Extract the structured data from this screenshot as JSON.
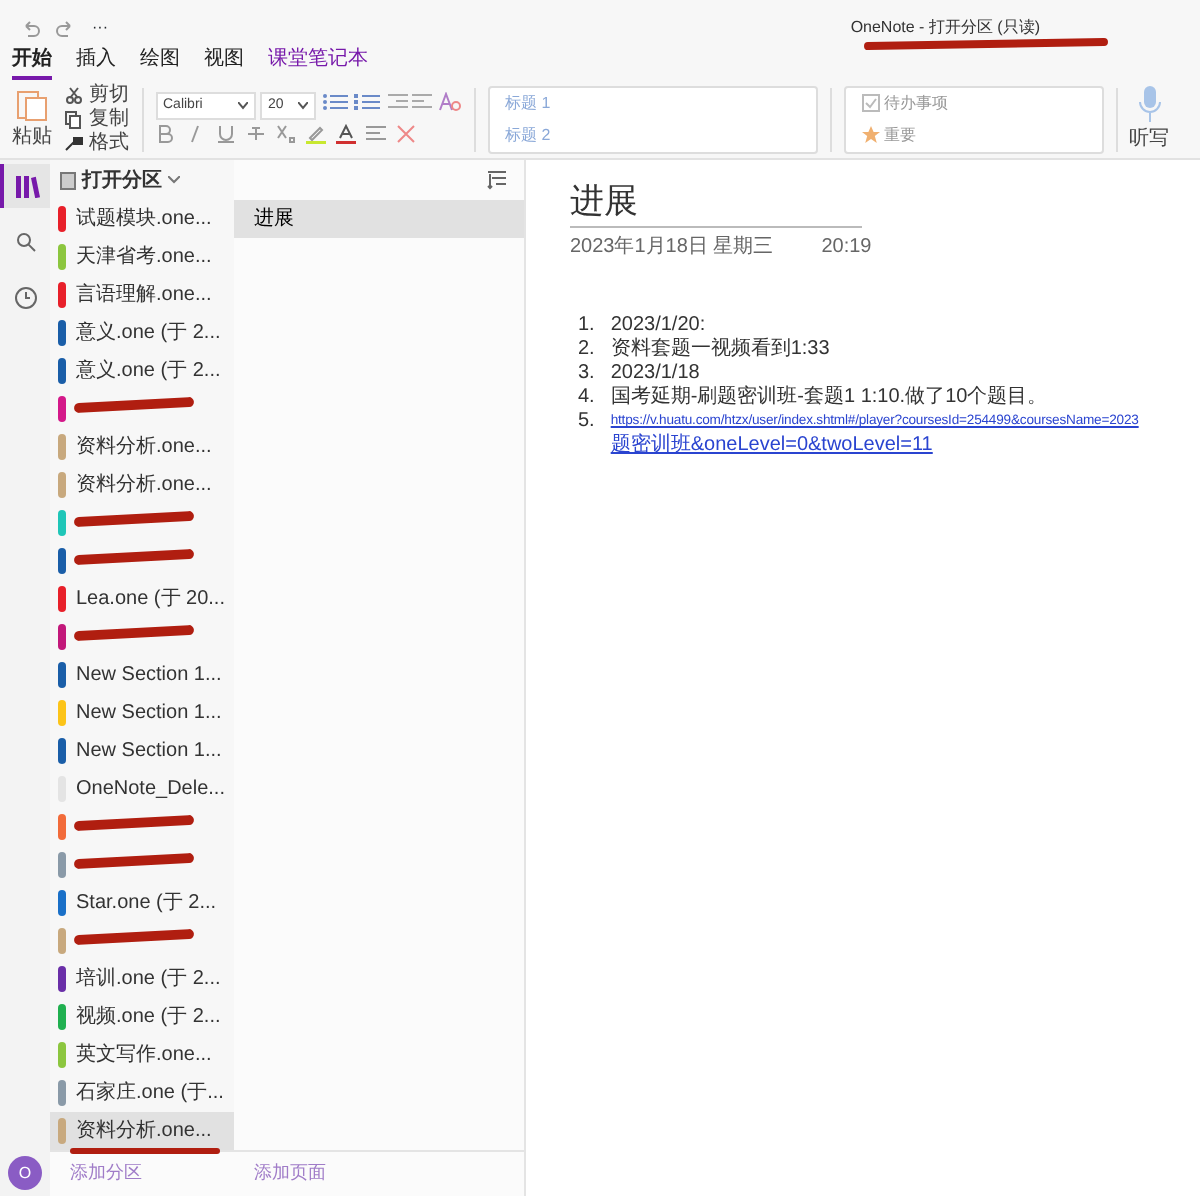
{
  "window": {
    "title": "OneNote - 打开分区 (只读)",
    "title_redacted": true,
    "more": "···"
  },
  "tabs": [
    {
      "label": "开始",
      "selected": true,
      "kind": "normal"
    },
    {
      "label": "插入",
      "selected": false,
      "kind": "normal"
    },
    {
      "label": "绘图",
      "selected": false,
      "kind": "normal"
    },
    {
      "label": "视图",
      "selected": false,
      "kind": "normal"
    },
    {
      "label": "课堂笔记本",
      "selected": false,
      "kind": "accent"
    }
  ],
  "ribbon": {
    "paste": "粘贴",
    "cut": "剪切",
    "copy": "复制",
    "format_painter": "格式",
    "font": "Calibri",
    "font_size": "20",
    "styles": [
      "标题 1",
      "标题 2"
    ],
    "tags": [
      {
        "label": "待办事项",
        "kind": "todo"
      },
      {
        "label": "重要",
        "kind": "star"
      }
    ],
    "dictate": "听写"
  },
  "sections_header": "打开分区",
  "sections": [
    {
      "label": "试题模块.one...",
      "color": "#e8202a",
      "selected": false
    },
    {
      "label": "天津省考.one...",
      "color": "#8cc63f",
      "selected": false
    },
    {
      "label": "言语理解.one...",
      "color": "#e8202a",
      "selected": false
    },
    {
      "label": "意义.one (于 2...",
      "color": "#1a5ea8",
      "selected": false
    },
    {
      "label": "意义.one (于 2...",
      "color": "#1a5ea8",
      "selected": false
    },
    {
      "color": "#d4198a",
      "selected": false,
      "redacted": true
    },
    {
      "label": "资料分析.one...",
      "color": "#c8a97e",
      "selected": false
    },
    {
      "label": "资料分析.one...",
      "color": "#c8a97e",
      "selected": false
    },
    {
      "color": "#1fc6b8",
      "selected": false,
      "redacted": true
    },
    {
      "color": "#1a5ea8",
      "selected": false,
      "redacted": true
    },
    {
      "label": "Lea.one (于 20...",
      "color": "#e8202a",
      "selected": false
    },
    {
      "color": "#c2187a",
      "selected": false,
      "redacted": true
    },
    {
      "label": "New Section 1...",
      "color": "#1a5ea8",
      "selected": false
    },
    {
      "label": "New Section 1...",
      "color": "#fcc419",
      "selected": false
    },
    {
      "label": "New Section 1...",
      "color": "#1a5ea8",
      "selected": false
    },
    {
      "label": "OneNote_Dele...",
      "color": "#e4e4e4",
      "selected": false
    },
    {
      "color": "#f26b3a",
      "selected": false,
      "redacted": true
    },
    {
      "color": "#8a9aa8",
      "selected": false,
      "redacted": true
    },
    {
      "label": "Star.one (于 2...",
      "color": "#1a70c8",
      "selected": false
    },
    {
      "color": "#c8a97e",
      "selected": false,
      "redacted": true
    },
    {
      "label": "培训.one (于 2...",
      "color": "#6a2fa8",
      "selected": false
    },
    {
      "label": "视频.one (于 2...",
      "color": "#20b050",
      "selected": false
    },
    {
      "label": "英文写作.one...",
      "color": "#8cc63f",
      "selected": false
    },
    {
      "label": "石家庄.one (于...",
      "color": "#8a9aa8",
      "selected": false
    },
    {
      "label": "资料分析.one...",
      "color": "#c8a97e",
      "selected": true,
      "redacted_underline": true
    }
  ],
  "pages": [
    {
      "label": "进展",
      "selected": true
    }
  ],
  "note": {
    "title": "进展",
    "date": "2023年1月18日 星期三",
    "time": "20:19",
    "items": [
      {
        "num": "1.",
        "kind": "text",
        "text": "2023/1/20:"
      },
      {
        "num": "2.",
        "kind": "text",
        "text": "资料套题一视频看到1:33"
      },
      {
        "num": "3.",
        "kind": "text",
        "text": "2023/1/18"
      },
      {
        "num": "4.",
        "kind": "text",
        "text": "国考延期-刷题密训班-套题1 1:10.做了10个题目。"
      },
      {
        "num": "5.",
        "kind": "link",
        "lines": [
          "https://v.huatu.com/htzx/user/index.shtml#/player?coursesId=254499&coursesName=2023",
          "题密训班&oneLevel=0&twoLevel=11"
        ]
      }
    ]
  },
  "footer": {
    "add_section": "添加分区",
    "add_page": "添加页面",
    "avatar": "O"
  }
}
